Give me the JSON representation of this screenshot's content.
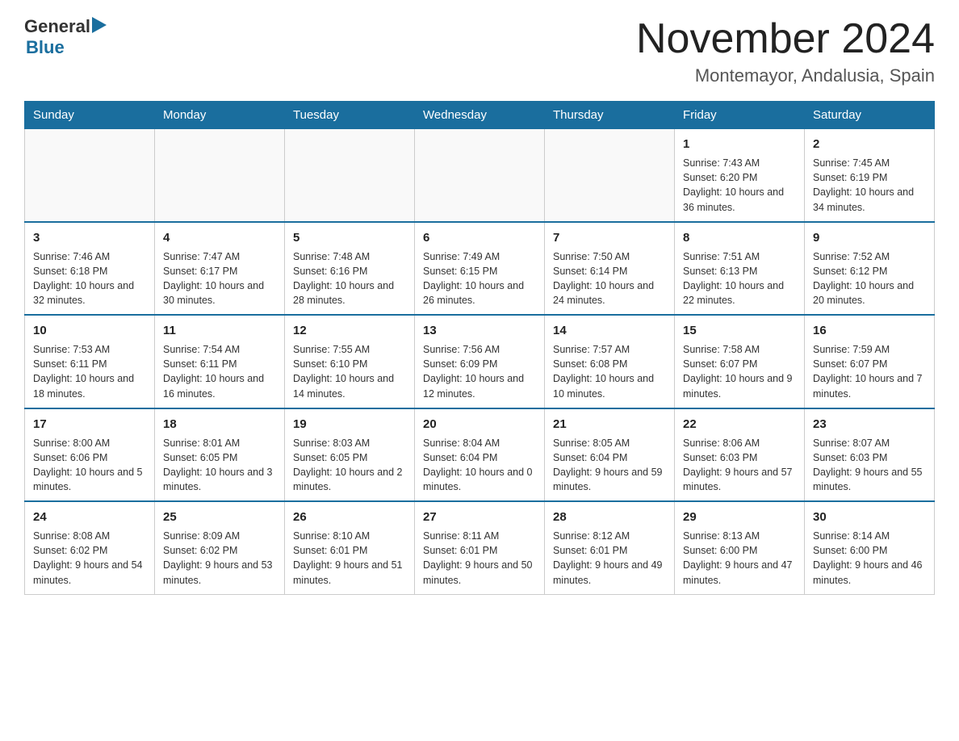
{
  "header": {
    "logo": {
      "general": "General",
      "blue": "Blue"
    },
    "month": "November 2024",
    "location": "Montemayor, Andalusia, Spain"
  },
  "weekdays": [
    "Sunday",
    "Monday",
    "Tuesday",
    "Wednesday",
    "Thursday",
    "Friday",
    "Saturday"
  ],
  "weeks": [
    [
      {
        "day": "",
        "info": ""
      },
      {
        "day": "",
        "info": ""
      },
      {
        "day": "",
        "info": ""
      },
      {
        "day": "",
        "info": ""
      },
      {
        "day": "",
        "info": ""
      },
      {
        "day": "1",
        "info": "Sunrise: 7:43 AM\nSunset: 6:20 PM\nDaylight: 10 hours and 36 minutes."
      },
      {
        "day": "2",
        "info": "Sunrise: 7:45 AM\nSunset: 6:19 PM\nDaylight: 10 hours and 34 minutes."
      }
    ],
    [
      {
        "day": "3",
        "info": "Sunrise: 7:46 AM\nSunset: 6:18 PM\nDaylight: 10 hours and 32 minutes."
      },
      {
        "day": "4",
        "info": "Sunrise: 7:47 AM\nSunset: 6:17 PM\nDaylight: 10 hours and 30 minutes."
      },
      {
        "day": "5",
        "info": "Sunrise: 7:48 AM\nSunset: 6:16 PM\nDaylight: 10 hours and 28 minutes."
      },
      {
        "day": "6",
        "info": "Sunrise: 7:49 AM\nSunset: 6:15 PM\nDaylight: 10 hours and 26 minutes."
      },
      {
        "day": "7",
        "info": "Sunrise: 7:50 AM\nSunset: 6:14 PM\nDaylight: 10 hours and 24 minutes."
      },
      {
        "day": "8",
        "info": "Sunrise: 7:51 AM\nSunset: 6:13 PM\nDaylight: 10 hours and 22 minutes."
      },
      {
        "day": "9",
        "info": "Sunrise: 7:52 AM\nSunset: 6:12 PM\nDaylight: 10 hours and 20 minutes."
      }
    ],
    [
      {
        "day": "10",
        "info": "Sunrise: 7:53 AM\nSunset: 6:11 PM\nDaylight: 10 hours and 18 minutes."
      },
      {
        "day": "11",
        "info": "Sunrise: 7:54 AM\nSunset: 6:11 PM\nDaylight: 10 hours and 16 minutes."
      },
      {
        "day": "12",
        "info": "Sunrise: 7:55 AM\nSunset: 6:10 PM\nDaylight: 10 hours and 14 minutes."
      },
      {
        "day": "13",
        "info": "Sunrise: 7:56 AM\nSunset: 6:09 PM\nDaylight: 10 hours and 12 minutes."
      },
      {
        "day": "14",
        "info": "Sunrise: 7:57 AM\nSunset: 6:08 PM\nDaylight: 10 hours and 10 minutes."
      },
      {
        "day": "15",
        "info": "Sunrise: 7:58 AM\nSunset: 6:07 PM\nDaylight: 10 hours and 9 minutes."
      },
      {
        "day": "16",
        "info": "Sunrise: 7:59 AM\nSunset: 6:07 PM\nDaylight: 10 hours and 7 minutes."
      }
    ],
    [
      {
        "day": "17",
        "info": "Sunrise: 8:00 AM\nSunset: 6:06 PM\nDaylight: 10 hours and 5 minutes."
      },
      {
        "day": "18",
        "info": "Sunrise: 8:01 AM\nSunset: 6:05 PM\nDaylight: 10 hours and 3 minutes."
      },
      {
        "day": "19",
        "info": "Sunrise: 8:03 AM\nSunset: 6:05 PM\nDaylight: 10 hours and 2 minutes."
      },
      {
        "day": "20",
        "info": "Sunrise: 8:04 AM\nSunset: 6:04 PM\nDaylight: 10 hours and 0 minutes."
      },
      {
        "day": "21",
        "info": "Sunrise: 8:05 AM\nSunset: 6:04 PM\nDaylight: 9 hours and 59 minutes."
      },
      {
        "day": "22",
        "info": "Sunrise: 8:06 AM\nSunset: 6:03 PM\nDaylight: 9 hours and 57 minutes."
      },
      {
        "day": "23",
        "info": "Sunrise: 8:07 AM\nSunset: 6:03 PM\nDaylight: 9 hours and 55 minutes."
      }
    ],
    [
      {
        "day": "24",
        "info": "Sunrise: 8:08 AM\nSunset: 6:02 PM\nDaylight: 9 hours and 54 minutes."
      },
      {
        "day": "25",
        "info": "Sunrise: 8:09 AM\nSunset: 6:02 PM\nDaylight: 9 hours and 53 minutes."
      },
      {
        "day": "26",
        "info": "Sunrise: 8:10 AM\nSunset: 6:01 PM\nDaylight: 9 hours and 51 minutes."
      },
      {
        "day": "27",
        "info": "Sunrise: 8:11 AM\nSunset: 6:01 PM\nDaylight: 9 hours and 50 minutes."
      },
      {
        "day": "28",
        "info": "Sunrise: 8:12 AM\nSunset: 6:01 PM\nDaylight: 9 hours and 49 minutes."
      },
      {
        "day": "29",
        "info": "Sunrise: 8:13 AM\nSunset: 6:00 PM\nDaylight: 9 hours and 47 minutes."
      },
      {
        "day": "30",
        "info": "Sunrise: 8:14 AM\nSunset: 6:00 PM\nDaylight: 9 hours and 46 minutes."
      }
    ]
  ]
}
